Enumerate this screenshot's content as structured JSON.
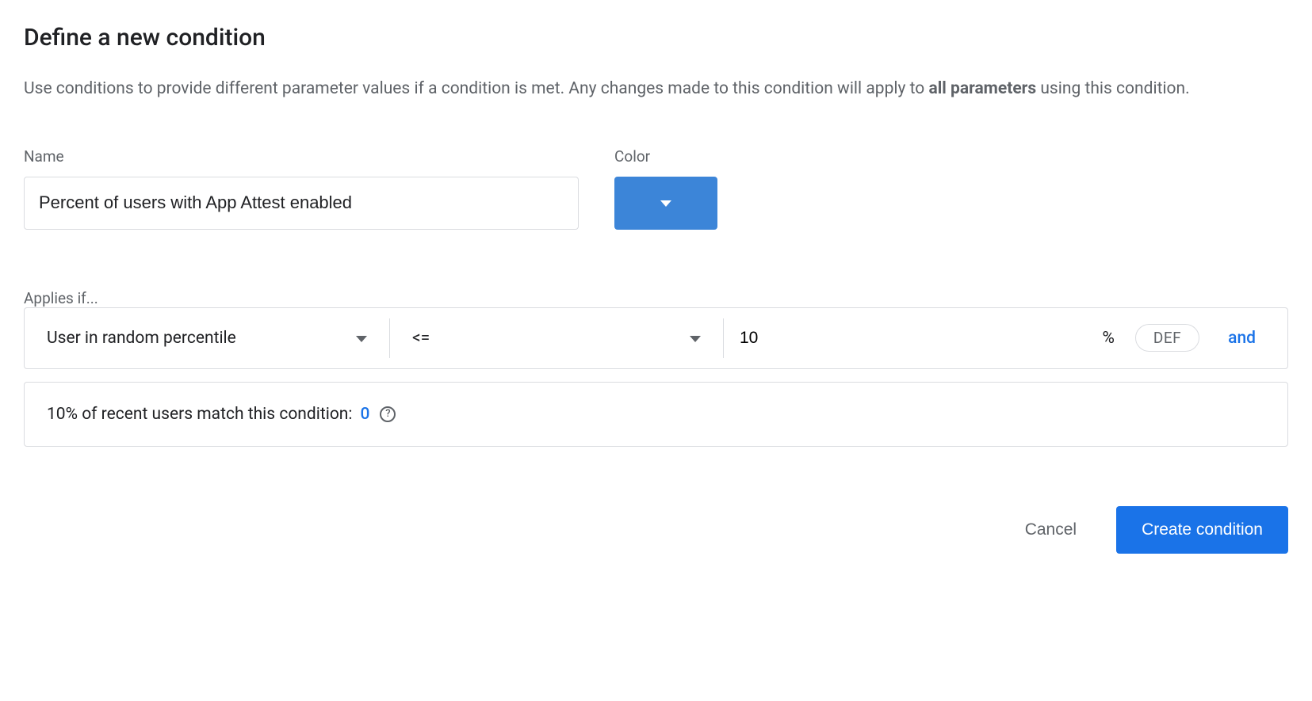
{
  "title": "Define a new condition",
  "description": {
    "pre": "Use conditions to provide different parameter values if a condition is met. Any changes made to this condition will apply to ",
    "bold": "all parameters",
    "post": " using this condition."
  },
  "labels": {
    "name": "Name",
    "color": "Color",
    "applies": "Applies if..."
  },
  "name_value": "Percent of users with App Attest enabled",
  "color_value": "#3c85d8",
  "condition": {
    "type": "User in random percentile",
    "operator": "<=",
    "value": "10",
    "unit": "%",
    "chip": "DEF",
    "and": "and"
  },
  "match": {
    "text": "10% of recent users match this condition: ",
    "count": "0"
  },
  "actions": {
    "cancel": "Cancel",
    "create": "Create condition"
  }
}
